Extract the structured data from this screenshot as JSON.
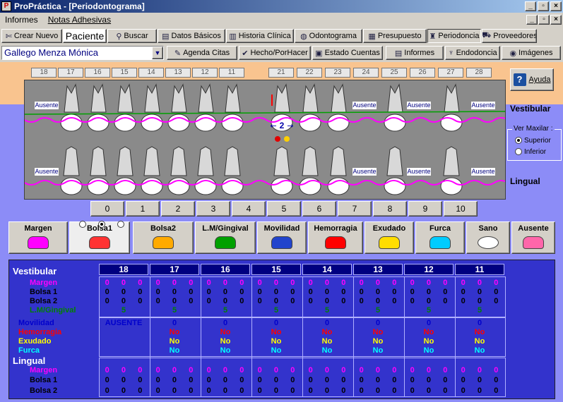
{
  "window": {
    "title": "ProPráctica - [Periodontograma]"
  },
  "menu": {
    "informes": "Informes",
    "notas": "Notas Adhesivas"
  },
  "toolbar1": [
    {
      "id": "crear-nuevo",
      "label": "Crear Nuevo",
      "icon": "scissors-icon",
      "glyph": "✄"
    },
    {
      "id": "paciente",
      "label": "Paciente",
      "icon": "",
      "glyph": ""
    },
    {
      "id": "buscar",
      "label": "Buscar",
      "icon": "binoculars-icon",
      "glyph": "⚲"
    },
    {
      "id": "datos-basicos",
      "label": "Datos Básicos",
      "icon": "card-icon",
      "glyph": "▤"
    },
    {
      "id": "historia-clinica",
      "label": "Historia Clínica",
      "icon": "printer-icon",
      "glyph": "▥"
    },
    {
      "id": "odontograma",
      "label": "Odontograma",
      "icon": "tooth-icon",
      "glyph": "◍"
    },
    {
      "id": "presupuesto",
      "label": "Presupuesto",
      "icon": "calculator-icon",
      "glyph": "▦"
    },
    {
      "id": "periodoncia",
      "label": "Periodoncia",
      "icon": "teeth-icon",
      "glyph": "♜"
    },
    {
      "id": "proveedores",
      "label": "Proveedores",
      "icon": "truck-icon",
      "glyph": "⛟"
    }
  ],
  "toolbar2": [
    {
      "id": "agenda-citas",
      "label": "Agenda Citas",
      "icon": "agenda-icon",
      "glyph": "✎"
    },
    {
      "id": "hecho-porhacer",
      "label": "Hecho/PorHacer",
      "icon": "check-icon",
      "glyph": "✔"
    },
    {
      "id": "estado-cuentas",
      "label": "Estado Cuentas",
      "icon": "cash-register-icon",
      "glyph": "▣"
    },
    {
      "id": "informes",
      "label": "Informes",
      "icon": "report-icon",
      "glyph": "▤"
    },
    {
      "id": "endodoncia",
      "label": "Endodoncia",
      "icon": "root-icon",
      "glyph": "♆"
    },
    {
      "id": "imagenes",
      "label": "Imágenes",
      "icon": "camera-icon",
      "glyph": "◉"
    }
  ],
  "patient": {
    "name": "Gallego Menza Mónica"
  },
  "chart": {
    "upper_numbers": [
      "18",
      "17",
      "16",
      "15",
      "14",
      "13",
      "12",
      "11",
      "21",
      "22",
      "23",
      "24",
      "25",
      "26",
      "27",
      "28"
    ],
    "absent_label": "Ausente",
    "measure_label": "2"
  },
  "scale": [
    "0",
    "1",
    "2",
    "3",
    "4",
    "5",
    "6",
    "7",
    "8",
    "9",
    "10"
  ],
  "ayuda": "Ayuda",
  "side": {
    "vestibular": "Vestibular",
    "lingual": "Lingual"
  },
  "maxilar": {
    "legend": "Ver Maxilar :",
    "superior": "Superior",
    "inferior": "Inferior",
    "selected": "superior"
  },
  "modes": [
    {
      "id": "margen",
      "label": "Margen"
    },
    {
      "id": "bolsa1",
      "label": "Bolsa1"
    },
    {
      "id": "bolsa2",
      "label": "Bolsa2"
    },
    {
      "id": "lm-gingival",
      "label": "L.M/Gingival"
    },
    {
      "id": "movilidad",
      "label": "Movilidad"
    },
    {
      "id": "hemorragia",
      "label": "Hemorragia"
    },
    {
      "id": "exudado",
      "label": "Exudado"
    },
    {
      "id": "furca",
      "label": "Furca"
    },
    {
      "id": "sano",
      "label": "Sano"
    },
    {
      "id": "ausente",
      "label": "Ausente"
    }
  ],
  "colors": {
    "margen": "#ff00ff",
    "bolsa": "#000000",
    "lmg": "#008000",
    "movilidad": "#0000cc",
    "hemorragia": "#ff0000",
    "exudado": "#ffff00",
    "furca": "#00ffff"
  },
  "table": {
    "vestibular_title": "Vestibular",
    "lingual_title": "Lingual",
    "teeth": [
      "18",
      "17",
      "16",
      "15",
      "14",
      "13",
      "12",
      "11"
    ],
    "labels": {
      "margen": "Margen",
      "bolsa1": "Bolsa 1",
      "bolsa2": "Bolsa 2",
      "lmg": "L.M/Gingival",
      "movilidad": "Movilidad",
      "hemorragia": "Hemorragia",
      "exudado": "Exudado",
      "furca": "Furca"
    },
    "margen_val": "0",
    "bolsa_val": "0",
    "lmg_val": "5",
    "movilidad": [
      "AUSENTE",
      "0",
      "0",
      "0",
      "0",
      "0",
      "0",
      "0"
    ],
    "no": "No"
  }
}
